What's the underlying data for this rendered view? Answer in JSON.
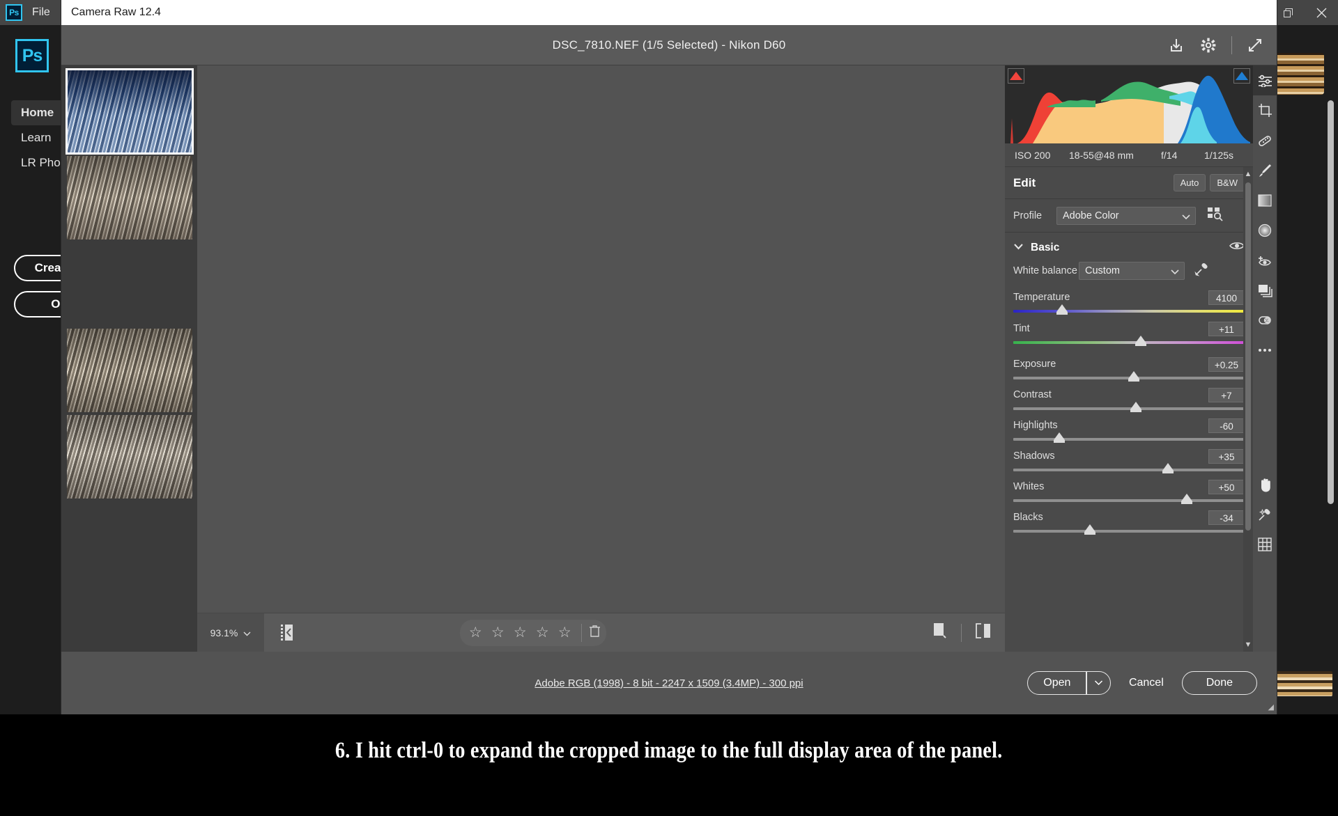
{
  "app": {
    "logo_text": "Ps",
    "menu": [
      "File"
    ],
    "window_buttons": [
      "restore-icon",
      "close-icon"
    ],
    "nav": [
      {
        "label": "Home",
        "active": true
      },
      {
        "label": "Learn",
        "active": false
      },
      {
        "label": "LR Photos",
        "active": false
      }
    ],
    "buttons": [
      {
        "label": "Create new"
      },
      {
        "label": "Open"
      }
    ]
  },
  "camera_raw": {
    "title": "Camera Raw 12.4",
    "file_title": "DSC_7810.NEF (1/5 Selected)  -  Nikon D60",
    "header_icons": [
      "save-icon",
      "gear-icon",
      "fullscreen-icon"
    ],
    "filmstrip": [
      {
        "name": "thumbnail-1",
        "selected": true
      },
      {
        "name": "thumbnail-2",
        "selected": false
      },
      {
        "name": "thumbnail-3",
        "selected": false
      },
      {
        "name": "thumbnail-4",
        "selected": false
      },
      {
        "name": "thumbnail-5",
        "selected": false
      }
    ],
    "toolbar": {
      "zoom_level": "93.1%",
      "filmstrip_toggle": "filmstrip-collapse-icon",
      "stars": [
        "☆",
        "☆",
        "☆",
        "☆",
        "☆"
      ],
      "delete_icon": "trash-icon",
      "single_view_icon": "single-view-icon",
      "compare_view_icon": "compare-view-icon"
    },
    "exif": {
      "iso": "ISO 200",
      "lens": "18-55@48 mm",
      "aperture": "f/14",
      "shutter": "1/125s"
    },
    "edit": {
      "title": "Edit",
      "auto_label": "Auto",
      "bw_label": "B&W",
      "profile_label": "Profile",
      "profile_value": "Adobe Color",
      "profile_browser_icon": "profile-browser-icon",
      "basic_title": "Basic",
      "basic_eye_icon": "eye-icon",
      "white_balance_label": "White balance",
      "white_balance_value": "Custom",
      "white_balance_picker_icon": "eyedropper-icon",
      "sliders": [
        {
          "label": "Temperature",
          "value": "4100",
          "pos": 21,
          "track": "temp"
        },
        {
          "label": "Tint",
          "value": "+11",
          "pos": 55,
          "track": "tint"
        },
        {
          "label": "Exposure",
          "value": "+0.25",
          "pos": 52,
          "track": "plain"
        },
        {
          "label": "Contrast",
          "value": "+7",
          "pos": 53,
          "track": "plain"
        },
        {
          "label": "Highlights",
          "value": "-60",
          "pos": 20,
          "track": "plain"
        },
        {
          "label": "Shadows",
          "value": "+35",
          "pos": 67,
          "track": "plain"
        },
        {
          "label": "Whites",
          "value": "+50",
          "pos": 75,
          "track": "plain"
        },
        {
          "label": "Blacks",
          "value": "-34",
          "pos": 33,
          "track": "plain"
        }
      ]
    },
    "tools": [
      {
        "name": "edit-sliders-icon",
        "active": true
      },
      {
        "name": "crop-icon",
        "active": false
      },
      {
        "name": "healing-brush-icon",
        "active": false
      },
      {
        "name": "adjustment-brush-icon",
        "active": false
      },
      {
        "name": "graduated-filter-icon",
        "active": false
      },
      {
        "name": "radial-filter-icon",
        "active": false
      },
      {
        "name": "red-eye-icon",
        "active": false
      },
      {
        "name": "snapshots-icon",
        "active": false
      },
      {
        "name": "presets-icon",
        "active": false
      },
      {
        "name": "more-options-icon",
        "active": false
      },
      {
        "name": "hand-tool-icon",
        "active": false
      },
      {
        "name": "white-balance-tool-icon",
        "active": false
      },
      {
        "name": "grid-overlay-icon",
        "active": false
      }
    ],
    "footer": {
      "info": "Adobe RGB (1998) - 8 bit - 2247 x 1509 (3.4MP) - 300 ppi",
      "open_label": "Open",
      "open_dropdown_icon": "chevron-down-icon",
      "cancel_label": "Cancel",
      "done_label": "Done"
    }
  },
  "caption": "6. I hit ctrl-0 to expand the cropped image to the full display area of the panel.",
  "colors": {
    "accent": "#31c5f0",
    "panel_bg": "#4a4a4a",
    "modal_bg": "#535353",
    "histogram_bg": "#2b2b2b",
    "clip_shadow": "#f2453d",
    "clip_highlight": "#1f7fd4"
  }
}
